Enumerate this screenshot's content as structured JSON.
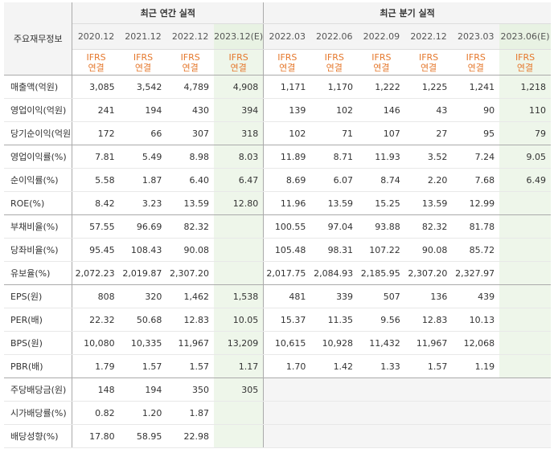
{
  "header": {
    "corner_label": "주요재무정보",
    "annual_group": "최근 연간 실적",
    "quarterly_group": "최근 분기 실적"
  },
  "annual_periods": [
    "2020.12",
    "2021.12",
    "2022.12",
    "2023.12(E)"
  ],
  "quarterly_periods": [
    "2022.03",
    "2022.06",
    "2022.09",
    "2022.12",
    "2023.03",
    "2023.06(E)"
  ],
  "accounting_line1": "IFRS",
  "accounting_line2": "연결",
  "rows": [
    {
      "label": "매출액(억원)",
      "annual": [
        "3,085",
        "3,542",
        "4,789",
        "4,908"
      ],
      "quarterly": [
        "1,171",
        "1,170",
        "1,222",
        "1,225",
        "1,241",
        "1,218"
      ]
    },
    {
      "label": "영업이익(억원)",
      "annual": [
        "241",
        "194",
        "430",
        "394"
      ],
      "quarterly": [
        "139",
        "102",
        "146",
        "43",
        "90",
        "110"
      ]
    },
    {
      "label": "당기순이익(억원)",
      "annual": [
        "172",
        "66",
        "307",
        "318"
      ],
      "quarterly": [
        "102",
        "71",
        "107",
        "27",
        "95",
        "79"
      ]
    },
    {
      "label": "영업이익률(%)",
      "annual": [
        "7.81",
        "5.49",
        "8.98",
        "8.03"
      ],
      "quarterly": [
        "11.89",
        "8.71",
        "11.93",
        "3.52",
        "7.24",
        "9.05"
      ]
    },
    {
      "label": "순이익률(%)",
      "annual": [
        "5.58",
        "1.87",
        "6.40",
        "6.47"
      ],
      "quarterly": [
        "8.69",
        "6.07",
        "8.74",
        "2.20",
        "7.68",
        "6.49"
      ]
    },
    {
      "label": "ROE(%)",
      "annual": [
        "8.42",
        "3.23",
        "13.59",
        "12.80"
      ],
      "quarterly": [
        "11.96",
        "13.59",
        "15.25",
        "13.59",
        "12.99",
        ""
      ]
    },
    {
      "label": "부채비율(%)",
      "annual": [
        "57.55",
        "96.69",
        "82.32",
        ""
      ],
      "quarterly": [
        "100.55",
        "97.04",
        "93.88",
        "82.32",
        "81.78",
        ""
      ]
    },
    {
      "label": "당좌비율(%)",
      "annual": [
        "95.45",
        "108.43",
        "90.08",
        ""
      ],
      "quarterly": [
        "105.48",
        "98.31",
        "107.22",
        "90.08",
        "85.72",
        ""
      ]
    },
    {
      "label": "유보율(%)",
      "annual": [
        "2,072.23",
        "2,019.87",
        "2,307.20",
        ""
      ],
      "quarterly": [
        "2,017.75",
        "2,084.93",
        "2,185.95",
        "2,307.20",
        "2,327.97",
        ""
      ]
    },
    {
      "label": "EPS(원)",
      "annual": [
        "808",
        "320",
        "1,462",
        "1,538"
      ],
      "quarterly": [
        "481",
        "339",
        "507",
        "136",
        "439",
        ""
      ]
    },
    {
      "label": "PER(배)",
      "annual": [
        "22.32",
        "50.68",
        "12.83",
        "10.05"
      ],
      "quarterly": [
        "15.37",
        "11.35",
        "9.56",
        "12.83",
        "10.13",
        ""
      ]
    },
    {
      "label": "BPS(원)",
      "annual": [
        "10,080",
        "10,335",
        "11,967",
        "13,209"
      ],
      "quarterly": [
        "10,615",
        "10,928",
        "11,432",
        "11,967",
        "12,068",
        ""
      ]
    },
    {
      "label": "PBR(배)",
      "annual": [
        "1.79",
        "1.57",
        "1.57",
        "1.17"
      ],
      "quarterly": [
        "1.70",
        "1.42",
        "1.33",
        "1.57",
        "1.19",
        ""
      ]
    },
    {
      "label": "주당배당금(원)",
      "annual": [
        "148",
        "194",
        "350",
        "305"
      ],
      "quarterly": [
        "",
        "",
        "",
        "",
        "",
        ""
      ]
    },
    {
      "label": "시가배당률(%)",
      "annual": [
        "0.82",
        "1.20",
        "1.87",
        ""
      ],
      "quarterly": [
        "",
        "",
        "",
        "",
        "",
        ""
      ]
    },
    {
      "label": "배당성향(%)",
      "annual": [
        "17.80",
        "58.95",
        "22.98",
        ""
      ],
      "quarterly": [
        "",
        "",
        "",
        "",
        "",
        ""
      ]
    }
  ]
}
